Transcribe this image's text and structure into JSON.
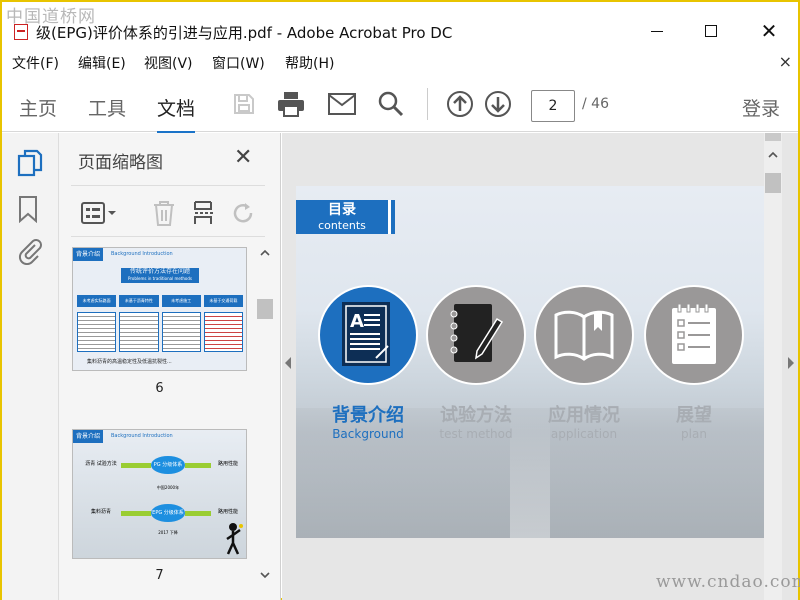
{
  "watermark_top": "中国道桥网",
  "watermark_bottom": "www.cndao.com",
  "window": {
    "title": "级(EPG)评价体系的引进与应用.pdf - Adobe Acrobat Pro DC",
    "close_glyph": "✕"
  },
  "menu": {
    "items": [
      "文件(F)",
      "编辑(E)",
      "视图(V)",
      "窗口(W)",
      "帮助(H)"
    ],
    "close_glyph": "×"
  },
  "toolbar": {
    "tabs": [
      "主页",
      "工具",
      "文档"
    ],
    "active_tab": "文档",
    "current_page": "2",
    "total_pages": "/ 46",
    "login_label": "登录"
  },
  "thumbnail_panel": {
    "title": "页面缩略图",
    "close_glyph": "✕",
    "pages": [
      {
        "number": "6",
        "header": "背景介绍",
        "header_en": "Background Introduction",
        "heading": "传统评价方法存在问题",
        "heading_en": "Problems in traditional methods",
        "columns": [
          "未考虑实际路面",
          "未基于沥青特性",
          "未考虑施工",
          "未基于交通荷载"
        ],
        "footer": "集料沥青的高温稳定性及低温抗裂性..."
      },
      {
        "number": "7",
        "header": "背景介绍",
        "header_en": "Background Introduction",
        "nodes": [
          "PG 分级体系",
          "EPG 分级体系"
        ],
        "left_nodes": [
          "沥青 试验方法",
          "集料沥青"
        ],
        "right_nodes": [
          "路用性能",
          "路用性能"
        ],
        "middle_label": "中国2000年",
        "bottom_label": "2017 下降"
      }
    ]
  },
  "slide": {
    "toc_title": "目录",
    "toc_subtitle": "contents",
    "items": [
      {
        "cn": "背景介绍",
        "en": "Background",
        "active": true
      },
      {
        "cn": "试验方法",
        "en": "test method",
        "active": false
      },
      {
        "cn": "应用情况",
        "en": "application",
        "active": false
      },
      {
        "cn": "展望",
        "en": "plan",
        "active": false
      }
    ]
  },
  "colors": {
    "accent": "#1d6fbf",
    "active_circle": "#1d6fbf",
    "inactive_circle": "#9a9898",
    "inactive_text": "#a8adb3",
    "tab_underline": "#1a73c8",
    "window_border": "#e8c400"
  },
  "icons": {
    "toolbar": [
      "save-icon",
      "print-icon",
      "mail-icon",
      "search-icon",
      "page-up-icon",
      "page-down-icon"
    ],
    "rail": [
      "page-thumbnails-icon",
      "bookmark-icon",
      "attachment-icon"
    ],
    "panel_tools": [
      "thumbnail-options-icon",
      "delete-page-icon",
      "insert-page-icon",
      "rotate-page-icon"
    ]
  }
}
